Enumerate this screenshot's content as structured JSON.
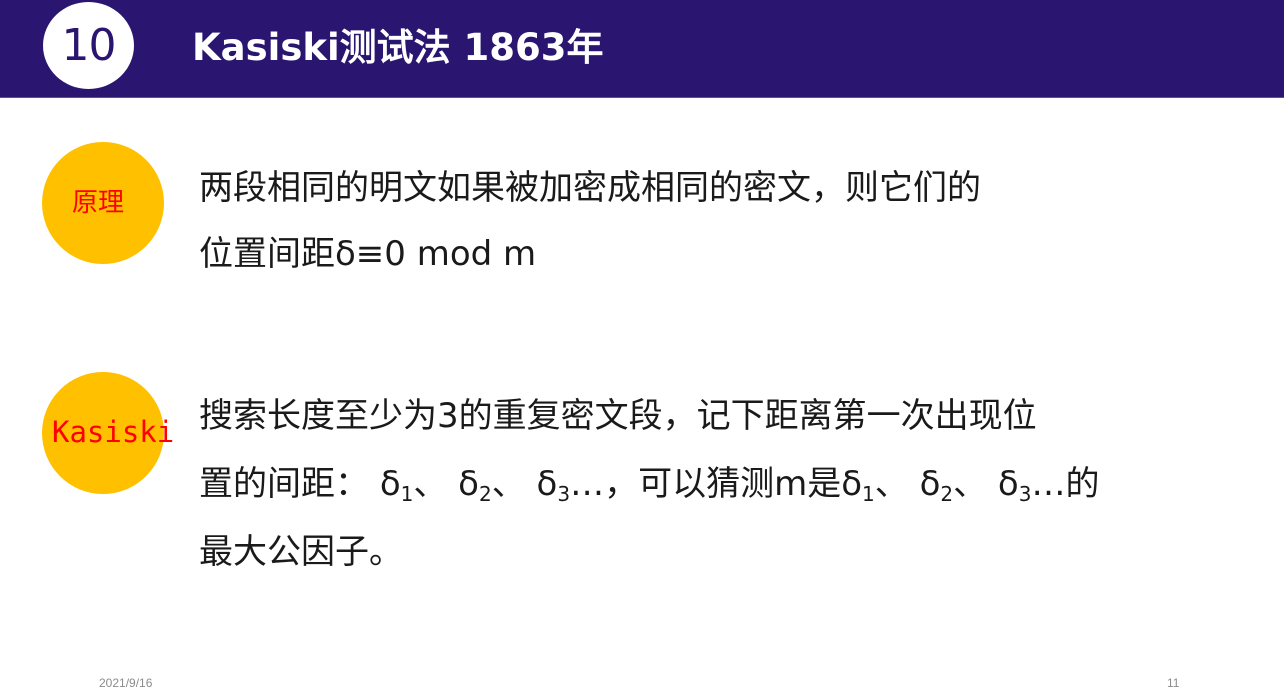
{
  "header": {
    "number": "10",
    "title": "Kasiski测试法 1863年",
    "colors": {
      "bar": "#2a1670",
      "title_text": "#ffffff"
    }
  },
  "principle": {
    "badge_label": "原理",
    "lines": [
      "两段相同的明文如果被加密成相同的密文，则它们的",
      "位置间距δ≡0 mod m"
    ]
  },
  "kasiski": {
    "badge_label": "Kasiski",
    "line1": "搜索长度至少为3的重复密文段，记下距离第一次出现位",
    "line2": {
      "prefix": "置的间距：",
      "delta": "δ",
      "sub1": "1",
      "sub2": "2",
      "sub3": "3",
      "sep": "、",
      "ellipsis": "…，",
      "middle": "可以猜测m是",
      "suffix": "…的"
    },
    "line3": "最大公因子。"
  },
  "footer": {
    "date": "2021/9/16",
    "page": "11"
  },
  "colors": {
    "badge_fill": "#ffc000",
    "badge_text": "#ff0000",
    "body_text": "#1a1a1a",
    "footer_text": "#8c8c8c"
  }
}
